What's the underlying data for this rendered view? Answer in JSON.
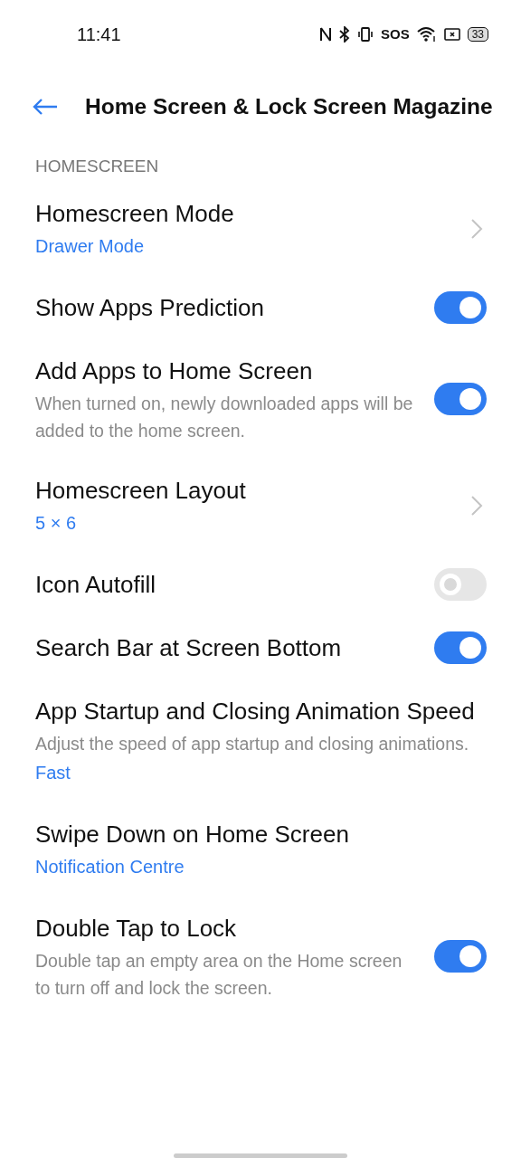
{
  "status_bar": {
    "time": "11:41",
    "sos": "SOS",
    "battery": "33"
  },
  "header": {
    "title": "Home Screen & Lock Screen Magazine"
  },
  "section": {
    "title": "HOMESCREEN"
  },
  "items": [
    {
      "kind": "nav",
      "title": "Homescreen Mode",
      "value": "Drawer Mode"
    },
    {
      "kind": "toggle",
      "title": "Show Apps Prediction",
      "on": true
    },
    {
      "kind": "toggle",
      "title": "Add Apps to Home Screen",
      "description": "When turned on, newly downloaded apps will be added to the home screen.",
      "on": true
    },
    {
      "kind": "nav",
      "title": "Homescreen Layout",
      "value": "5 × 6"
    },
    {
      "kind": "toggle",
      "title": "Icon Autofill",
      "on": false
    },
    {
      "kind": "toggle",
      "title": "Search Bar at Screen Bottom",
      "on": true
    },
    {
      "kind": "plain",
      "title": "App Startup and Closing Animation Speed",
      "description": "Adjust the speed of app startup and closing animations.",
      "value": "Fast"
    },
    {
      "kind": "plain",
      "title": "Swipe Down on Home Screen",
      "value": "Notification Centre"
    },
    {
      "kind": "toggle",
      "title": "Double Tap to Lock",
      "description": "Double tap an empty area on the Home screen to turn off and lock the screen.",
      "on": true
    }
  ]
}
